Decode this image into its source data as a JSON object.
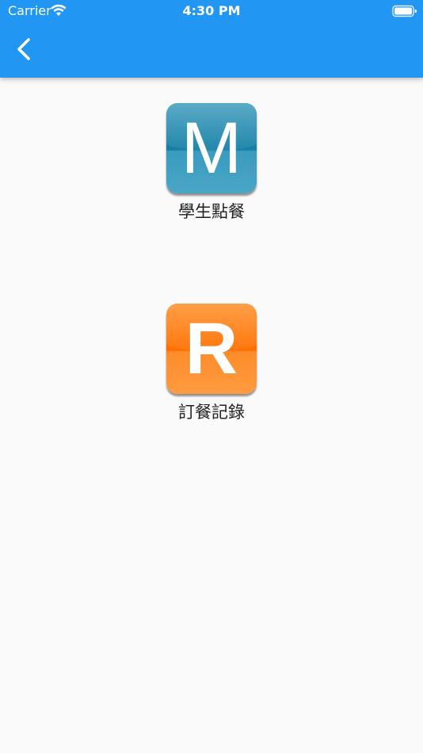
{
  "status_bar": {
    "carrier": "Carrier",
    "time": "4:30 PM",
    "wifi_icon": "wifi-icon",
    "battery_icon": "battery-icon"
  },
  "appbar": {
    "back_icon": "chevron-left-icon",
    "color": "#2196f3"
  },
  "menu": [
    {
      "icon_letter": "M",
      "label": "學生點餐",
      "color": "#167fa6"
    },
    {
      "icon_letter": "R",
      "label": "訂餐記錄",
      "color": "#ff6f00"
    }
  ]
}
